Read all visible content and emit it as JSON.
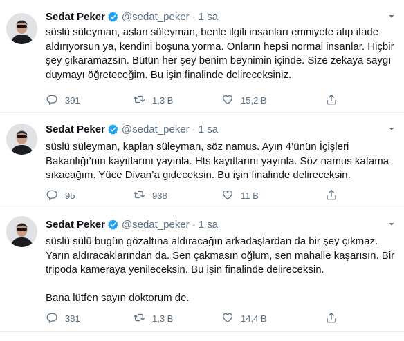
{
  "colors": {
    "text": "#0f1419",
    "secondary": "#5b7083",
    "verified": "#1da1f2",
    "divider": "#e6ecf0"
  },
  "icons": {
    "verified": "verified-badge-icon",
    "more": "more-options-icon",
    "reply": "reply-icon",
    "retweet": "retweet-icon",
    "like": "like-icon",
    "share": "share-icon"
  },
  "tweets": [
    {
      "name": "Sedat Peker",
      "handle": "@sedat_peker",
      "dot": "·",
      "time": "1 sa",
      "lines": [
        "süslü süleyman, aslan süleyman, benle ilgili insanları emniyete alıp ifade",
        "aldırıyorsun ya, kendini boşuna yorma. Onların hepsi normal insanlar. Hiçbir",
        "şey çıkaramazsın. Bütün her şey benim beynimin içinde. Size zekaya saygı",
        "duymayı öğreteceğim. Bu işin finalinde delireceksiniz."
      ],
      "replies": "391",
      "retweets": "1,3 B",
      "likes": "15,2 B"
    },
    {
      "name": "Sedat Peker",
      "handle": "@sedat_peker",
      "dot": "·",
      "time": "1 sa",
      "lines": [
        "süslü süleyman, kaplan süleyman, söz namus. Ayın 4’ünün İçişleri",
        "Bakanlığı’nın kayıtlarını yayınla. Hts kayıtlarını yayınla. Söz namus kafama",
        "sıkacağım. Yüce Divan’a gideceksin. Bu işin finalinde delireceksin."
      ],
      "replies": "95",
      "retweets": "938",
      "likes": "11 B"
    },
    {
      "name": "Sedat Peker",
      "handle": "@sedat_peker",
      "dot": "·",
      "time": "1 sa",
      "lines": [
        "süslü sülü bugün gözaltına aldıracağın arkadaşlardan da bir şey çıkmaz.",
        "Yarın aldıracaklarından da. Sen çakmasın oğlum, sen mahalle kaşarısın. Bir",
        "tripoda kameraya yenileceksin. Bu işin finalinde delireceksin.",
        "",
        "Bana lütfen sayın doktorum de."
      ],
      "replies": "381",
      "retweets": "1,3 B",
      "likes": "14,4 B"
    }
  ]
}
